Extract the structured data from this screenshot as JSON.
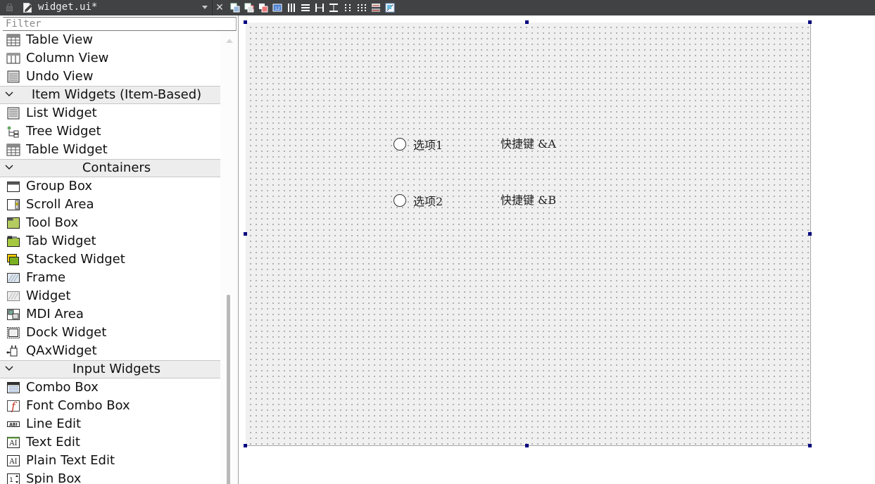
{
  "editor": {
    "filename": "widget.ui*",
    "close_symbol": "✕",
    "tools": [
      "edit-widgets-icon",
      "edit-signals-slots-icon",
      "edit-buddies-icon",
      "edit-tab-order-icon",
      "lay-out-horizontally-icon",
      "lay-out-vertically-icon",
      "lay-out-horizontal-splitter-icon",
      "lay-out-vertical-splitter-icon",
      "lay-out-form-icon",
      "lay-out-grid-icon",
      "break-layout-icon",
      "adjust-size-icon"
    ]
  },
  "widgetbox": {
    "filter_placeholder": "Filter",
    "items": [
      {
        "type": "item",
        "label": "Table View",
        "icon": "table-view-icon"
      },
      {
        "type": "item",
        "label": "Column View",
        "icon": "column-view-icon"
      },
      {
        "type": "item",
        "label": "Undo View",
        "icon": "undo-view-icon"
      },
      {
        "type": "category",
        "label": "Item Widgets (Item-Based)"
      },
      {
        "type": "item",
        "label": "List Widget",
        "icon": "list-widget-icon"
      },
      {
        "type": "item",
        "label": "Tree Widget",
        "icon": "tree-widget-icon"
      },
      {
        "type": "item",
        "label": "Table Widget",
        "icon": "table-widget-icon"
      },
      {
        "type": "category",
        "label": "Containers"
      },
      {
        "type": "item",
        "label": "Group Box",
        "icon": "group-box-icon"
      },
      {
        "type": "item",
        "label": "Scroll Area",
        "icon": "scroll-area-icon"
      },
      {
        "type": "item",
        "label": "Tool Box",
        "icon": "tool-box-icon"
      },
      {
        "type": "item",
        "label": "Tab Widget",
        "icon": "tab-widget-icon"
      },
      {
        "type": "item",
        "label": "Stacked Widget",
        "icon": "stacked-widget-icon"
      },
      {
        "type": "item",
        "label": "Frame",
        "icon": "frame-icon"
      },
      {
        "type": "item",
        "label": "Widget",
        "icon": "widget-icon"
      },
      {
        "type": "item",
        "label": "MDI Area",
        "icon": "mdi-area-icon"
      },
      {
        "type": "item",
        "label": "Dock Widget",
        "icon": "dock-widget-icon"
      },
      {
        "type": "item",
        "label": "QAxWidget",
        "icon": "qaxwidget-icon"
      },
      {
        "type": "category",
        "label": "Input Widgets"
      },
      {
        "type": "item",
        "label": "Combo Box",
        "icon": "combo-box-icon"
      },
      {
        "type": "item",
        "label": "Font Combo Box",
        "icon": "font-combo-box-icon"
      },
      {
        "type": "item",
        "label": "Line Edit",
        "icon": "line-edit-icon"
      },
      {
        "type": "item",
        "label": "Text Edit",
        "icon": "text-edit-icon"
      },
      {
        "type": "item",
        "label": "Plain Text Edit",
        "icon": "plain-text-edit-icon"
      },
      {
        "type": "item",
        "label": "Spin Box",
        "icon": "spin-box-icon"
      }
    ]
  },
  "form": {
    "radio1": "选项1",
    "radio2": "选项2",
    "shortcut1": "快捷键 &A",
    "shortcut2": "快捷键 &B"
  }
}
